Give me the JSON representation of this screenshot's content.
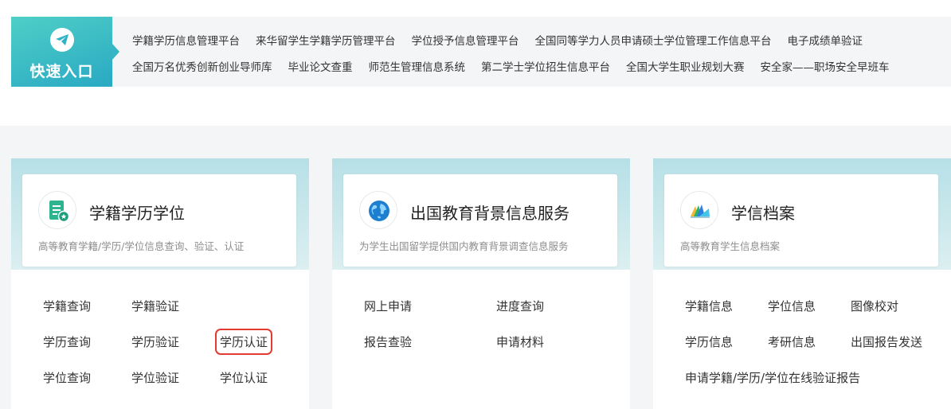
{
  "quick_entry": {
    "title": "快速入口",
    "row1": [
      "学籍学历信息管理平台",
      "来华留学生学籍学历管理平台",
      "学位授予信息管理平台",
      "全国同等学力人员申请硕士学位管理工作信息平台",
      "电子成绩单验证"
    ],
    "row2": [
      "全国万名优秀创新创业导师库",
      "毕业论文查重",
      "师范生管理信息系统",
      "第二学士学位招生信息平台",
      "全国大学生职业规划大赛",
      "安全家——职场安全早班车"
    ]
  },
  "cards": [
    {
      "title": "学籍学历学位",
      "subtitle": "高等教育学籍/学历/学位信息查询、验证、认证",
      "icon": "document-star-icon",
      "links": [
        "学籍查询",
        "学籍验证",
        "学历查询",
        "学历验证",
        "学历认证",
        "学位查询",
        "学位验证",
        "学位认证"
      ]
    },
    {
      "title": "出国教育背景信息服务",
      "subtitle": "为学生出国留学提供国内教育背景调查信息服务",
      "icon": "globe-icon",
      "links": [
        "网上申请",
        "进度查询",
        "报告查验",
        "申请材料"
      ]
    },
    {
      "title": "学信档案",
      "subtitle": "高等教育学生信息档案",
      "icon": "folder-stack-icon",
      "links": [
        "学籍信息",
        "学位信息",
        "图像校对",
        "学历信息",
        "考研信息",
        "出国报告发送",
        "申请学籍/学历/学位在线验证报告"
      ]
    }
  ],
  "colors": {
    "accent": "#2fb3c4",
    "highlight": "#e23b31"
  }
}
